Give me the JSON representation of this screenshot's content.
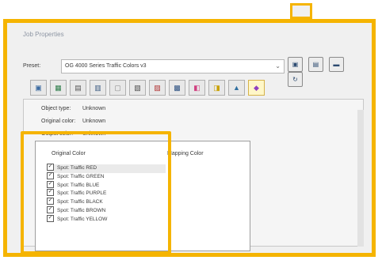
{
  "window": {
    "title": "Job Properties"
  },
  "preset": {
    "label": "Preset:",
    "value": "OG 4000 Series Traffic Colors v3",
    "buttons": [
      "save-preset",
      "save-as-preset",
      "manage-presets",
      "reset-preset"
    ]
  },
  "tabs": [
    {
      "icon": "image-icon",
      "glyph": "▣"
    },
    {
      "icon": "layout-icon",
      "glyph": "▦"
    },
    {
      "icon": "page-icon",
      "glyph": "▤"
    },
    {
      "icon": "monitor-icon",
      "glyph": "▥"
    },
    {
      "icon": "frame-icon",
      "glyph": "▢"
    },
    {
      "icon": "document-icon",
      "glyph": "▧"
    },
    {
      "icon": "calibration-icon",
      "glyph": "▨"
    },
    {
      "icon": "printer-icon",
      "glyph": "▩"
    },
    {
      "icon": "color-swatch-icon",
      "glyph": "◧"
    },
    {
      "icon": "channels-icon",
      "glyph": "◨"
    },
    {
      "icon": "mountain-icon",
      "glyph": "▲"
    },
    {
      "icon": "color-mapping-icon",
      "glyph": "◆"
    }
  ],
  "properties": {
    "object_type_label": "Object type:",
    "object_type_value": "Unknown",
    "original_color_label": "Original color:",
    "original_color_value": "Unknown",
    "output_color_label": "Output color:",
    "output_color_value": "Unknown"
  },
  "mapping": {
    "original_header": "Original Color",
    "mapping_header": "Mapping Color",
    "items": [
      "Spot: Traffic RED",
      "Spot: Traffic GREEN",
      "Spot: Traffic BLUE",
      "Spot: Traffic PURPLE",
      "Spot: Traffic BLACK",
      "Spot: Traffic BROWN",
      "Spot: Traffic YELLOW"
    ]
  },
  "colors": {
    "highlight": "#f5b400",
    "window_bg": "#f0f0f0"
  }
}
